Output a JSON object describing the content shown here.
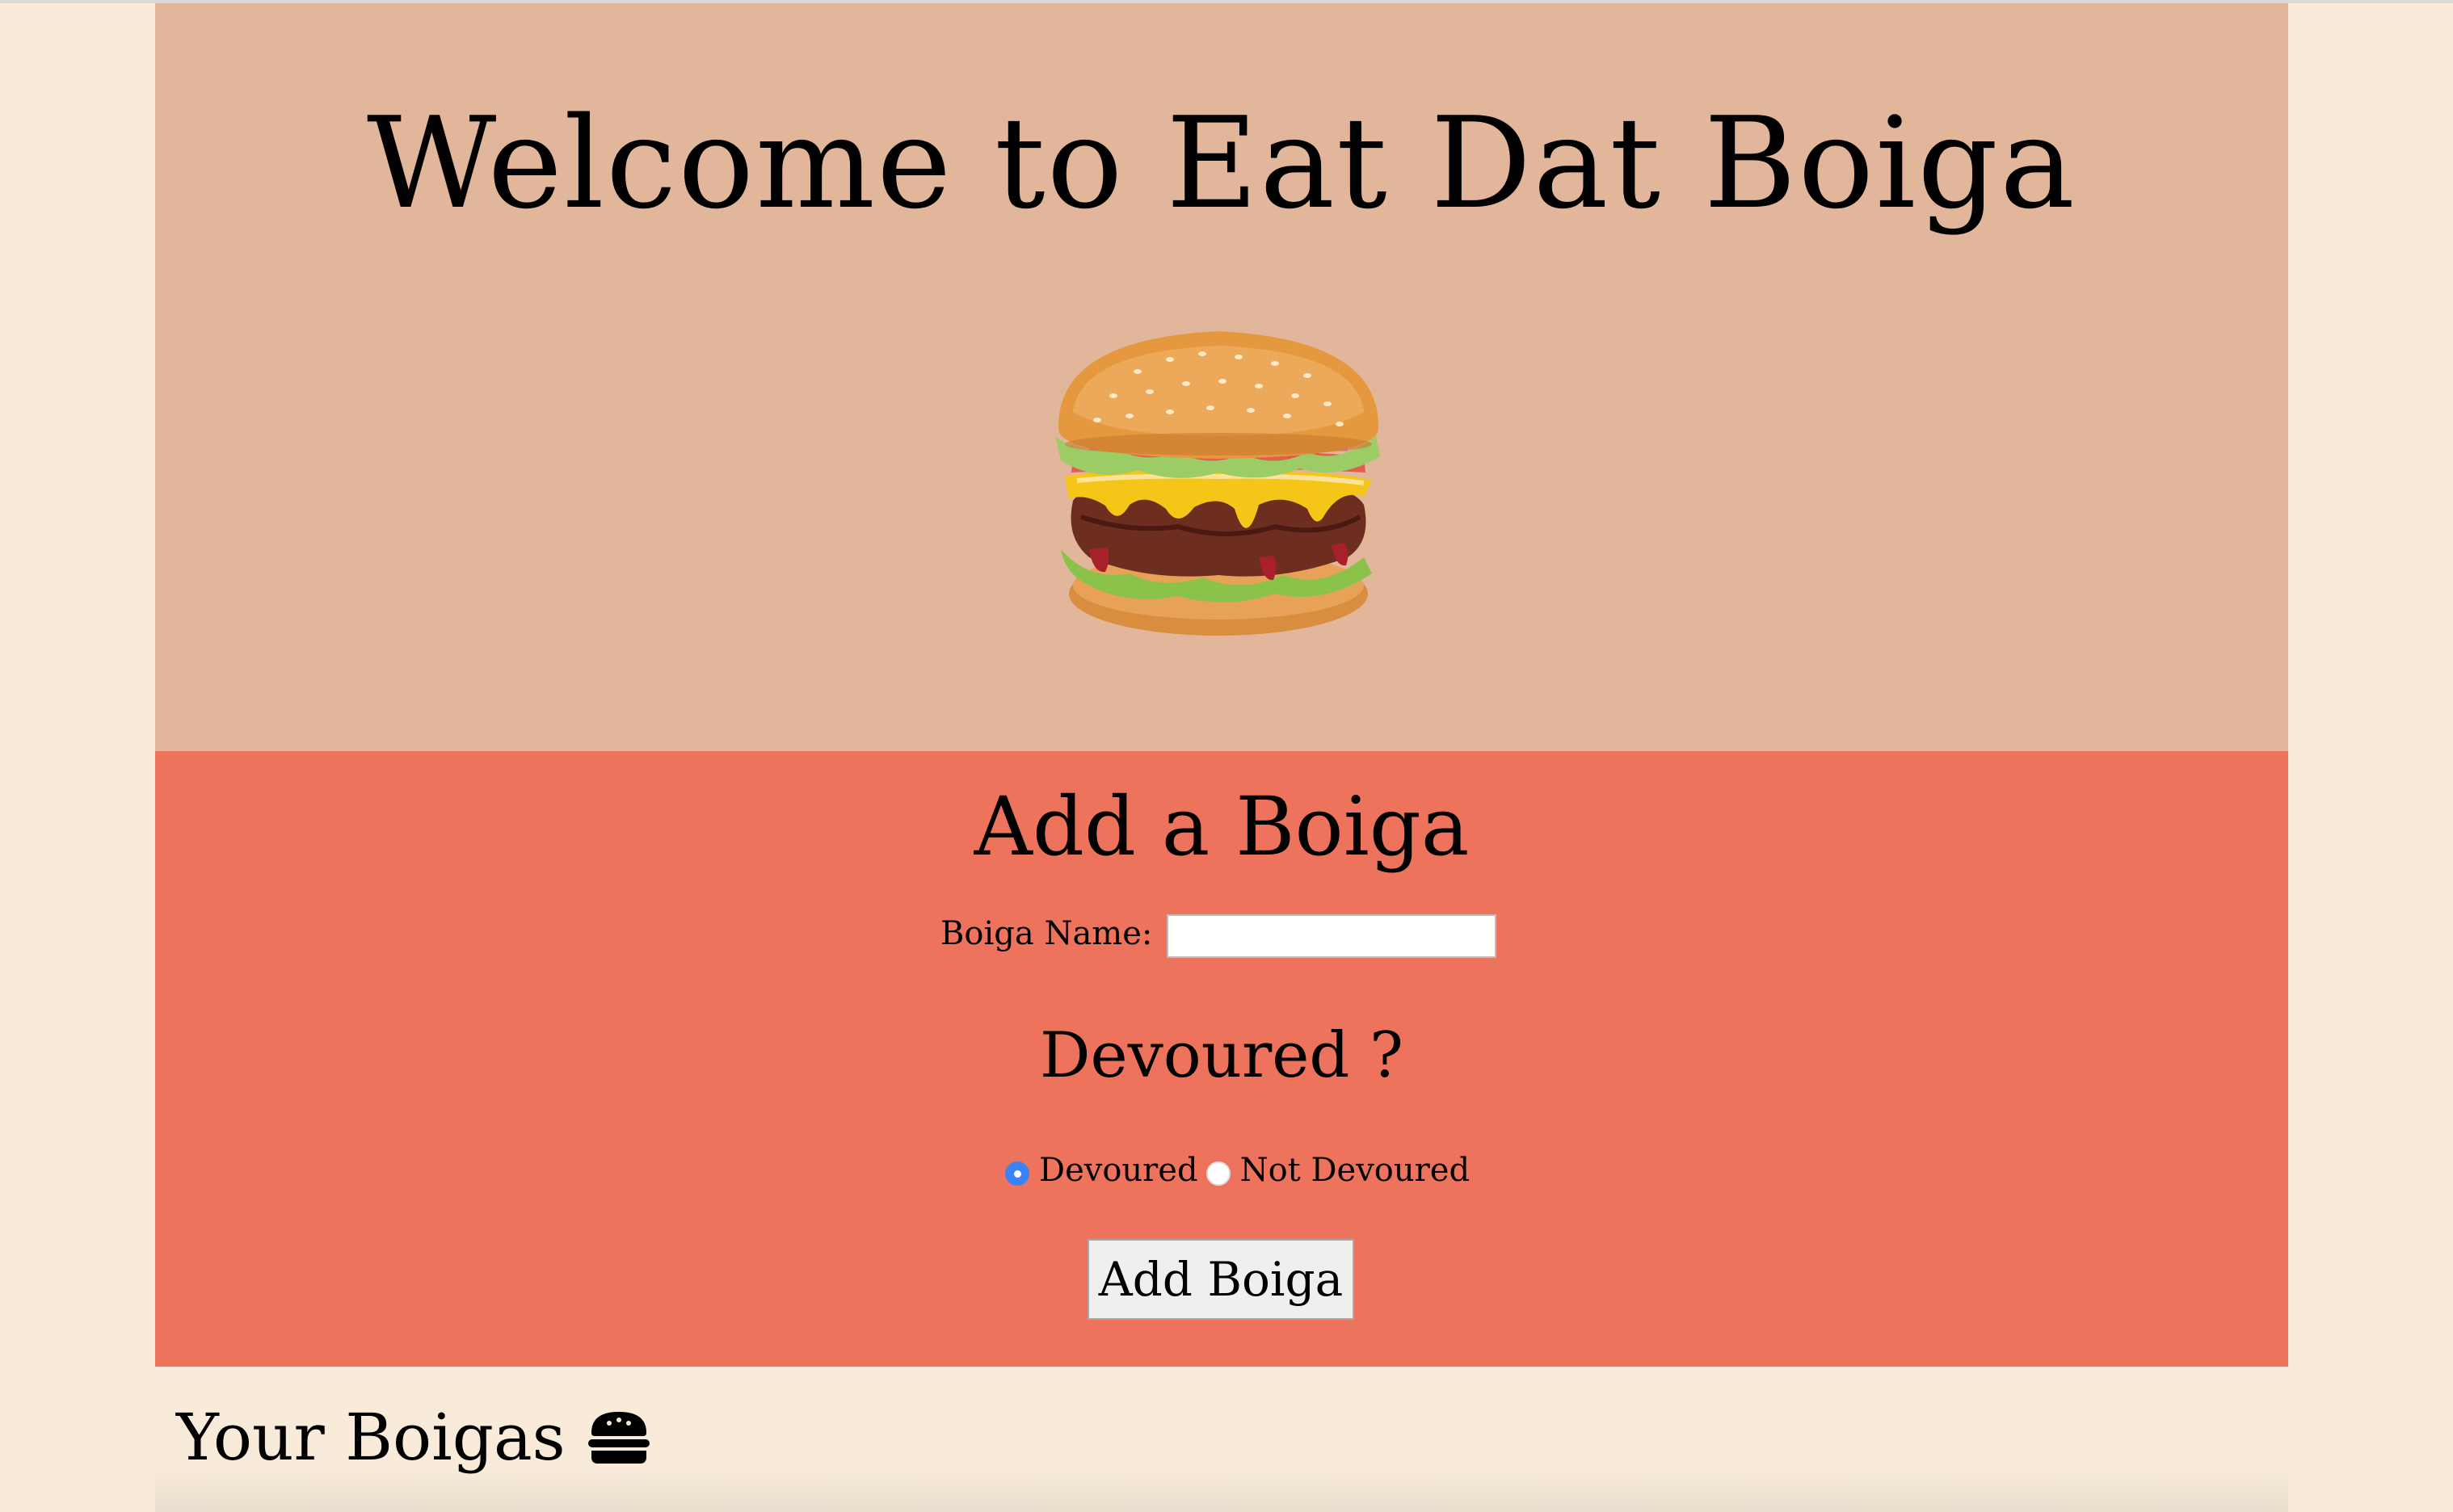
{
  "header": {
    "title": "Welcome to Eat Dat Boiga"
  },
  "hero_image": {
    "icon": "burger-image"
  },
  "form": {
    "title": "Add a Boiga",
    "name_label": "Boiga Name:",
    "name_value": "",
    "devoured_title": "Devoured ?",
    "options": [
      {
        "label": "Devoured",
        "selected": true
      },
      {
        "label": "Not Devoured",
        "selected": false
      }
    ],
    "submit_label": "Add Boiga"
  },
  "list": {
    "title": "Your Boigas",
    "icon": "hamburger-icon"
  },
  "colors": {
    "background": "#f8ebda",
    "hero": "#e1b69a",
    "form_section": "#ee735c",
    "radio_selected": "#3b82f6"
  }
}
